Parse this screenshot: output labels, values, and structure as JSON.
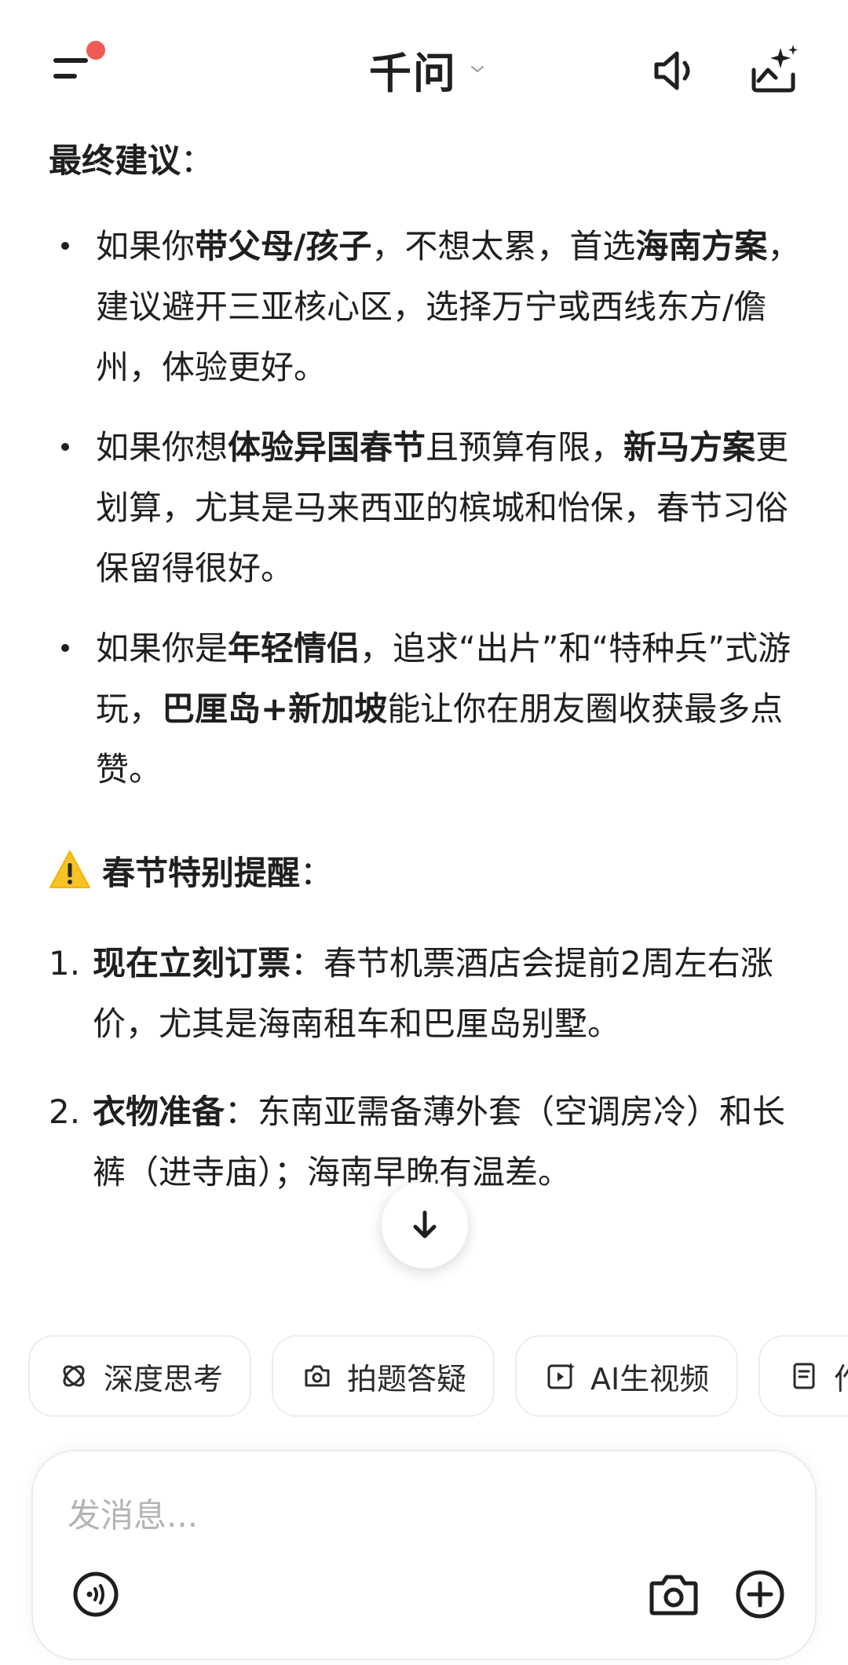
{
  "header": {
    "title": "千问",
    "icons": [
      "menu-icon",
      "chevron-down-icon",
      "speaker-icon",
      "sparkle-icon"
    ],
    "notification_dot_color": "#ef5b55"
  },
  "final_advice": {
    "heading": "最终建议",
    "colon": "：",
    "bullets": [
      {
        "p1": "如果你",
        "b1": "带父母/孩子",
        "p2": "，不想太累，首选",
        "b2": "海南方案",
        "p3": "，建议避开三亚核心区，选择万宁或西线东方/儋州，体验更好。"
      },
      {
        "p1": "如果你想",
        "b1": "体验异国春节",
        "p2": "且预算有限，",
        "b2": "新马方案",
        "p3": "更划算，尤其是马来西亚的槟城和怡保，春节习俗保留得很好。"
      },
      {
        "p1": "如果你是",
        "b1": "年轻情侣",
        "p2": "，追求“出片”和“特种兵”式游玩，",
        "b2": "巴厘岛+新加坡",
        "p3": "能让你在朋友圈收获最多点赞。"
      }
    ]
  },
  "reminder": {
    "icon": "warning-icon",
    "heading": "春节特别提醒",
    "colon": "：",
    "items": [
      {
        "num": "1.",
        "bold": "现在立刻订票",
        "text": "：春节机票酒店会提前2周左右涨价，尤其是海南租车和巴厘岛别墅。"
      },
      {
        "num": "2.",
        "bold": "衣物准备",
        "text": "：东南亚需备薄外套（空调房冷）和长裤（进寺庙）；海南早晚有温差。"
      }
    ]
  },
  "quick_actions": [
    {
      "label": "深度思考",
      "icon": "deep-think-icon"
    },
    {
      "label": "拍题答疑",
      "icon": "camera-question-icon"
    },
    {
      "label": "AI生视频",
      "icon": "ai-video-icon"
    },
    {
      "label": "作",
      "icon": "document-icon"
    }
  ],
  "composer": {
    "placeholder": "发消息..."
  }
}
